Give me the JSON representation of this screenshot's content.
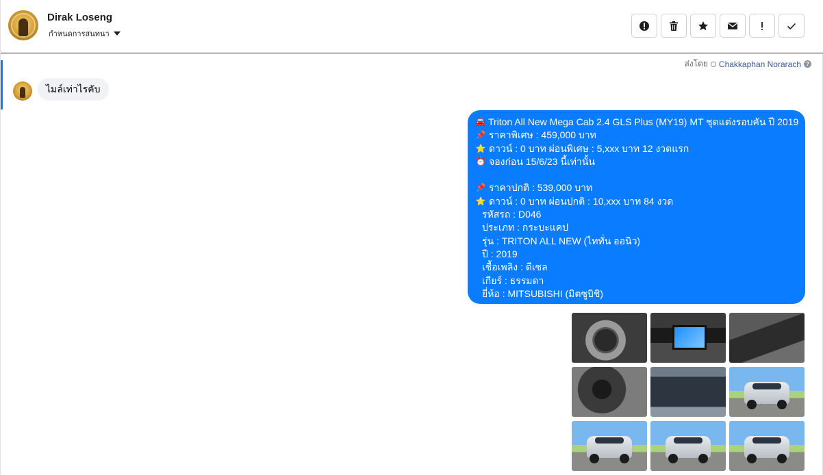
{
  "header": {
    "contact_name": "Dirak Loseng",
    "status_label": "กำหนดการสนทนา"
  },
  "toolbar": {
    "buttons": [
      {
        "name": "spam",
        "icon": "alert-circle-icon"
      },
      {
        "name": "delete",
        "icon": "trash-icon"
      },
      {
        "name": "star",
        "icon": "star-icon"
      },
      {
        "name": "mark-unread",
        "icon": "envelope-icon"
      },
      {
        "name": "follow-up",
        "icon": "exclamation-icon"
      },
      {
        "name": "done",
        "icon": "check-icon"
      }
    ]
  },
  "sent_by": {
    "label": "ส่งโดย",
    "agent": "Chakkaphan Norarach"
  },
  "incoming_message": "ไมล์เท่าไรคับ",
  "outgoing_message": {
    "lines": [
      {
        "icon": "🚘",
        "text": "Triton All New Mega Cab 2.4 GLS Plus (MY19) MT ชุดแต่งรอบคัน ปี 2019"
      },
      {
        "icon": "📌",
        "text": "ราคาพิเศษ : 459,000 บาท"
      },
      {
        "icon": "⭐",
        "text": "ดาวน์ : 0 บาท ผ่อนพิเศษ : 5,xxx บาท 12 งวดแรก"
      },
      {
        "icon": "⏰",
        "text": "จองก่อน 15/6/23 นี้เท่านั้น"
      },
      {
        "icon": "",
        "text": ""
      },
      {
        "icon": "📌",
        "text": "ราคาปกติ : 539,000 บาท"
      },
      {
        "icon": "⭐",
        "text": "ดาวน์ : 0 บาท ผ่อนปกติ : 10,xxx บาท 84 งวด"
      },
      {
        "icon": "",
        "text": "รหัสรถ : D046"
      },
      {
        "icon": "",
        "text": "ประเภท : กระบะแคป"
      },
      {
        "icon": "",
        "text": "รุ่น : TRITON ALL NEW (ไททั่น ออนิว)"
      },
      {
        "icon": "",
        "text": "ปี : 2019"
      },
      {
        "icon": "",
        "text": "เชื้อเพลิง : ดีเซล"
      },
      {
        "icon": "",
        "text": "เกียร์ : ธรรมดา"
      },
      {
        "icon": "",
        "text": "ยี่ห้อ : MITSUBISHI (มิตซูบิชิ)"
      }
    ]
  },
  "photos": [
    "steering-wheel",
    "dashboard-screen",
    "front-seats",
    "gear-shifter",
    "engine-bay",
    "truck-front-angle",
    "truck-front",
    "truck-side-front",
    "truck-rear-angle"
  ],
  "colors": {
    "outgoing_bubble": "#0a7cff",
    "incoming_bubble": "#f0f2f5",
    "agent_link": "#385898",
    "accent": "#1877f2"
  }
}
